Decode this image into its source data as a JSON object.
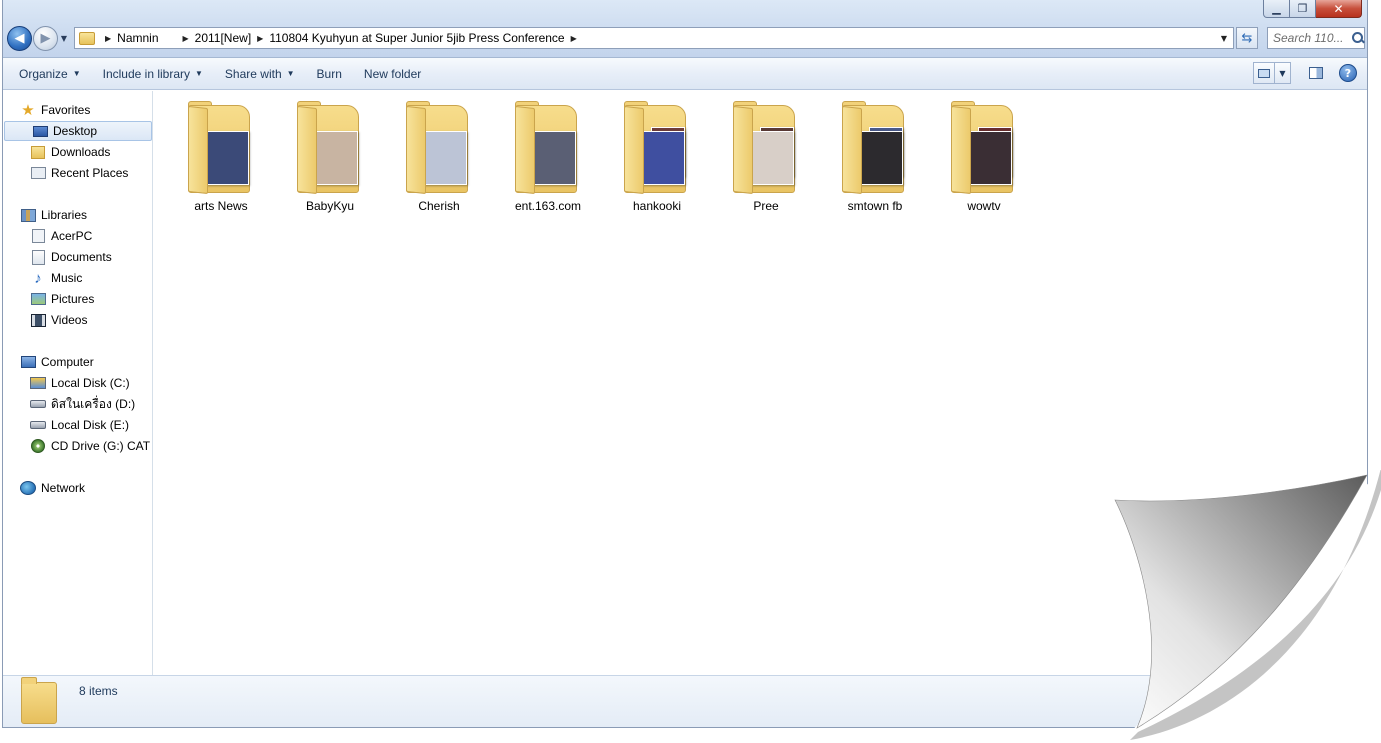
{
  "window": {
    "caption_buttons": {
      "minimize": "▁",
      "maximize": "❐",
      "close": "✕"
    }
  },
  "address_bar": {
    "crumbs": [
      "Namnin",
      "2011[New]",
      "110804 Kyuhyun at Super Junior 5jib Press Conference"
    ],
    "icon": "folder-icon"
  },
  "search": {
    "placeholder": "Search 110..."
  },
  "command_bar": {
    "organize": "Organize",
    "include_in_library": "Include in library",
    "share_with": "Share with",
    "burn": "Burn",
    "new_folder": "New folder",
    "help": "?"
  },
  "nav_pane": {
    "favorites": {
      "label": "Favorites",
      "icon": "star-icon"
    },
    "favorites_items": [
      {
        "label": "Desktop",
        "icon": "desktop-icon",
        "selected": true
      },
      {
        "label": "Downloads",
        "icon": "downloads-folder-icon"
      },
      {
        "label": "Recent Places",
        "icon": "recent-places-icon"
      }
    ],
    "libraries": {
      "label": "Libraries",
      "icon": "library-icon"
    },
    "libraries_items": [
      {
        "label": "AcerPC",
        "icon": "user-folder-icon"
      },
      {
        "label": "Documents",
        "icon": "documents-icon"
      },
      {
        "label": "Music",
        "icon": "music-note-icon"
      },
      {
        "label": "Pictures",
        "icon": "pictures-icon"
      },
      {
        "label": "Videos",
        "icon": "videos-icon"
      }
    ],
    "computer": {
      "label": "Computer",
      "icon": "computer-icon"
    },
    "computer_items": [
      {
        "label": "Local Disk (C:)",
        "icon": "system-disk-icon"
      },
      {
        "label": "ดิสในเครื่อง (D:)",
        "icon": "disk-icon"
      },
      {
        "label": "Local Disk (E:)",
        "icon": "disk-icon"
      },
      {
        "label": "CD Drive (G:) CAT (",
        "icon": "cd-drive-icon"
      }
    ],
    "network": {
      "label": "Network",
      "icon": "network-icon"
    }
  },
  "folders": [
    {
      "label": "arts News",
      "photo": "#3b4a78",
      "photo2": ""
    },
    {
      "label": "BabyKyu",
      "photo": "#c8b4a2",
      "photo2": ""
    },
    {
      "label": "Cherish",
      "photo": "#bcc4d6",
      "photo2": ""
    },
    {
      "label": "ent.163.com",
      "photo": "#5a5f74",
      "photo2": ""
    },
    {
      "label": "hankooki",
      "photo": "#3f4fa0",
      "photo2": "#6f3d3a"
    },
    {
      "label": "Pree",
      "photo": "#d8cfc8",
      "photo2": "#5b3a36"
    },
    {
      "label": "smtown fb",
      "photo": "#2c2a2e",
      "photo2": "#4a5a8a"
    },
    {
      "label": "wowtv",
      "photo": "#3a2e34",
      "photo2": "#6a2f30"
    }
  ],
  "details": {
    "count": "8 items"
  }
}
